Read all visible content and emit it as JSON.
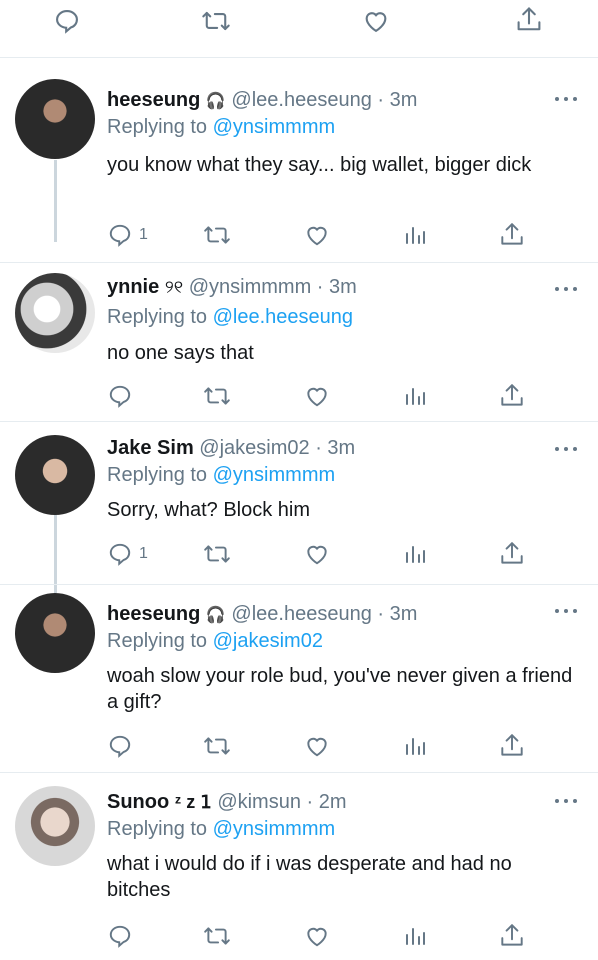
{
  "colors": {
    "link": "#1da1f2",
    "secondary": "#657786",
    "divider": "#e6ecf0",
    "thread": "#ccd6dd"
  },
  "top_actions": [
    "reply-icon",
    "retweet-icon",
    "like-icon",
    "share-icon"
  ],
  "replying_label": "Replying to",
  "tweets": [
    {
      "name": "heeseung",
      "badge": "🎧",
      "handle": "@lee.heeseung",
      "time": "· 3m",
      "replying_to": "@ynsimmmm",
      "text": "you know what they say... big wallet, bigger dick",
      "reply_count": "1"
    },
    {
      "name": "ynnie",
      "badge": "୨୧",
      "handle": "@ynsimmmm",
      "time": "· 3m",
      "replying_to": "@lee.heeseung",
      "text": "no one says that",
      "reply_count": ""
    },
    {
      "name": "Jake Sim",
      "badge": "",
      "handle": "@jakesim02",
      "time": "· 3m",
      "replying_to": "@ynsimmmm",
      "text": "Sorry, what? Block him",
      "reply_count": "1"
    },
    {
      "name": "heeseung",
      "badge": "🎧",
      "handle": "@lee.heeseung",
      "time": "· 3m",
      "replying_to": "@jakesim02",
      "text": "woah slow your role bud, you've never given a friend a gift?",
      "reply_count": ""
    },
    {
      "name": "Sunoo",
      "badge": "ᶻ z 𝟣",
      "handle": "@kimsun",
      "time": "· 2m",
      "replying_to": "@ynsimmmm",
      "text": "what i would do if i was desperate and had no bitches",
      "reply_count": ""
    }
  ]
}
